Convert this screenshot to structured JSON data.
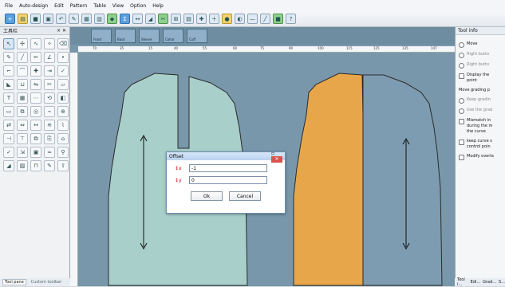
{
  "menu": [
    "File",
    "Auto-design",
    "Edit",
    "Pattern",
    "Table",
    "View",
    "Option",
    "Help"
  ],
  "toolbar_icons": [
    "new-icon",
    "open-icon",
    "save-icon",
    "save-as-icon",
    "undo-icon",
    "pen-icon",
    "table-icon",
    "grid-icon",
    "pattern-icon",
    "symbol-icon",
    "measure-icon",
    "shape-icon",
    "sew-icon",
    "grading-icon",
    "calendar-icon",
    "tools-icon",
    "plus-icon",
    "circle-icon",
    "color-icon",
    "minus-icon",
    "line-icon",
    "square-icon",
    "help-icon"
  ],
  "left_pane": {
    "title": "工具栏",
    "tabs": [
      "Tool pane",
      "Custom toolbar"
    ]
  },
  "workspace": {
    "thumbnails": [
      "Front",
      "Back",
      "Sleeve",
      "Collar",
      "Cuff"
    ],
    "ruler_ticks": [
      "70",
      "35",
      "15",
      "40",
      "55",
      "60",
      "75",
      "90",
      "100",
      "115",
      "125",
      "135",
      "147"
    ],
    "fills": {
      "left": "#a8cfca",
      "right": "#e8a64b",
      "line": "#2b2b2b"
    }
  },
  "dialog": {
    "title": "Offset",
    "x_value": "-1",
    "y_value": "0",
    "ok": "Ok",
    "cancel": "Cancel"
  },
  "right_pane": {
    "title": "Tool info",
    "move": "Move",
    "right_button_1": "Right butto",
    "right_button_2": "Right butto",
    "display_text": "Display the",
    "point": "point",
    "grading_title": "Move grading p",
    "keep_grading": "Keep gradin",
    "use_grading": "Use the grad",
    "mismatch": "Mismatch in",
    "during": "during the m",
    "curve": "the curve",
    "keep_curve": "keep curve s",
    "control_point": "control poin",
    "modify": "Modify overla",
    "tabs": [
      "Tool i...",
      "Edi...",
      "Grad...",
      "S..."
    ]
  }
}
